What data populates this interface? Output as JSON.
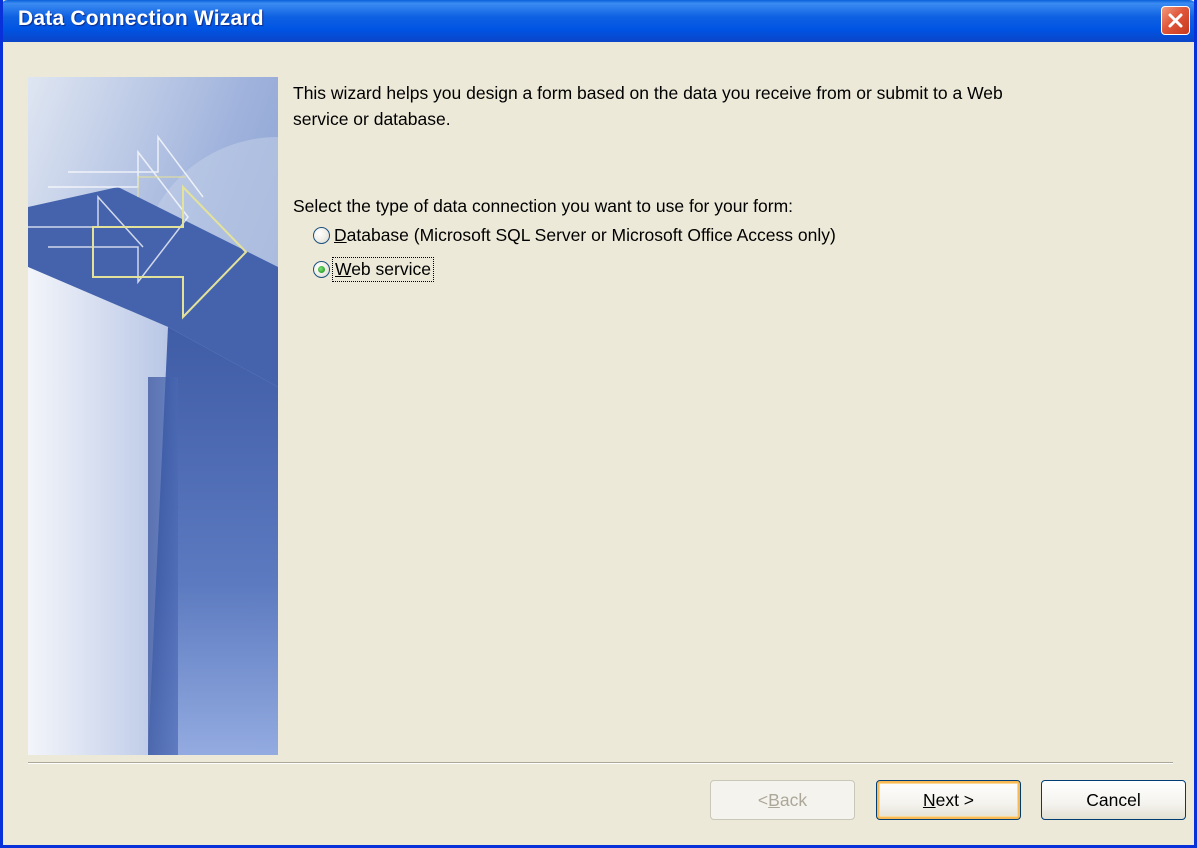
{
  "window": {
    "title": "Data Connection Wizard"
  },
  "content": {
    "intro_line1": "This wizard helps you design a form based on the data you receive from or submit to a Web",
    "intro_line2": "service or database.",
    "prompt": "Select the type of data connection you want to use for your form:",
    "options": [
      {
        "accel": "D",
        "rest": "atabase (Microsoft SQL Server or Microsoft Office Access only)",
        "selected": false
      },
      {
        "accel": "W",
        "rest": "eb service",
        "selected": true
      }
    ]
  },
  "buttons": {
    "back_prefix": "< ",
    "back_accel": "B",
    "back_rest": "ack",
    "next_accel": "N",
    "next_rest": "ext >",
    "cancel": "Cancel"
  },
  "colors": {
    "dialog_bg": "#ece9d8",
    "titlebar": "#0054e3",
    "close_button": "#e0573b",
    "radio_selected": "#2fa42b",
    "graphic_blue": "#7f98cf",
    "arrow_outline": "#e3e29a"
  },
  "icons": {
    "close": "close-icon"
  }
}
